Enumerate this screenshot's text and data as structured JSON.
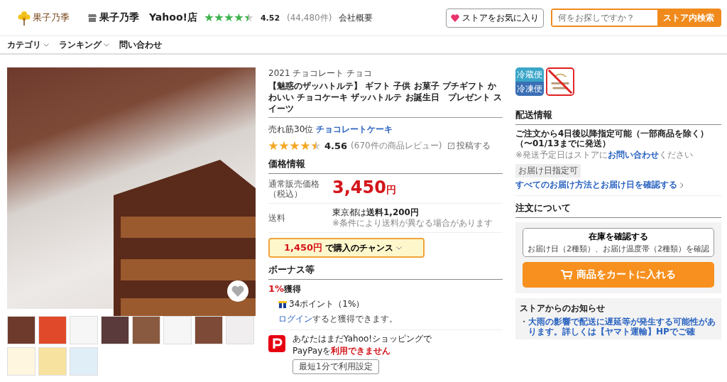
{
  "header": {
    "logo_text": "果子乃季",
    "store_name": "果子乃季　Yahoo!店",
    "stars": 4.5,
    "rating": "4.52",
    "review_count": "(44,480件)",
    "company_link": "会社概要",
    "favorite_button": "ストアをお気に入り",
    "search": {
      "placeholder": "何をお探しですか？"
    },
    "search_button": "ストア内検索"
  },
  "nav": [
    {
      "label": "カテゴリ",
      "dropdown": true
    },
    {
      "label": "ランキング",
      "dropdown": true
    },
    {
      "label": "問い合わせ",
      "dropdown": false
    }
  ],
  "gallery": {
    "favorited": false
  },
  "product": {
    "category_path": "2021 チョコレート チョコ",
    "title": "【魅惑のザッハトルテ】 ギフト 子供 お菓子 プチギフト かわいい チョコケーキ ザッハトルテ お誕生日　プレゼント スイーツ",
    "rank_text": "売れ筋30位",
    "rank_category": "チョコレートケーキ",
    "stars": 4.5,
    "rating": "4.56",
    "review_count": "(670件の商品レビュー)",
    "post_link": "投稿する"
  },
  "price": {
    "heading": "価格情報",
    "label_lines": [
      "通常販売価格",
      "（税込）"
    ],
    "amount": "3,450",
    "currency": "円",
    "shipping_label": "送料",
    "shipping_text": "東京都は**送料1,200円**",
    "shipping_note": "※条件により送料が異なる場合があります",
    "chance_amount": "1,450円",
    "chance_text": "で購入のチャンス"
  },
  "bonus": {
    "heading": "ボーナス等",
    "rate": "1%",
    "rate_label": "獲得",
    "points": "34ポイント（1%）",
    "login_link": "ログイン",
    "login_text": "すると獲得できます。"
  },
  "paypay": {
    "line1": "あなたはまだYahoo!ショッピングで",
    "line2_prefix": "PayPayを",
    "line2_warning": "利用できません",
    "button": "最短1分で利用設定"
  },
  "badges": [
    "冷蔵便",
    "冷凍便"
  ],
  "delivery": {
    "heading": "配送情報",
    "main": "ご注文から4日後以降指定可能（一部商品を除く）（〜01/13までに発送）",
    "note_prefix": "※発送予定日はストアに",
    "note_link": "お問い合わせ",
    "note_suffix": "ください",
    "tag": "お届け日指定可",
    "all_link": "すべてのお届け方法とお届け日を確認する"
  },
  "order": {
    "heading": "注文について",
    "stock_title": "在庫を確認する",
    "stock_sub": "お届け日（2種類）、お届け温度帯（2種類）を確認",
    "cart_button": "商品をカートに入れる"
  },
  "notice": {
    "heading": "ストアからのお知らせ",
    "items": [
      {
        "bullet": "・",
        "text": "大雨の影響で配送に遅延等が発生する可能性があります。詳しくは【ヤマト運輸】HPでご確"
      }
    ]
  }
}
